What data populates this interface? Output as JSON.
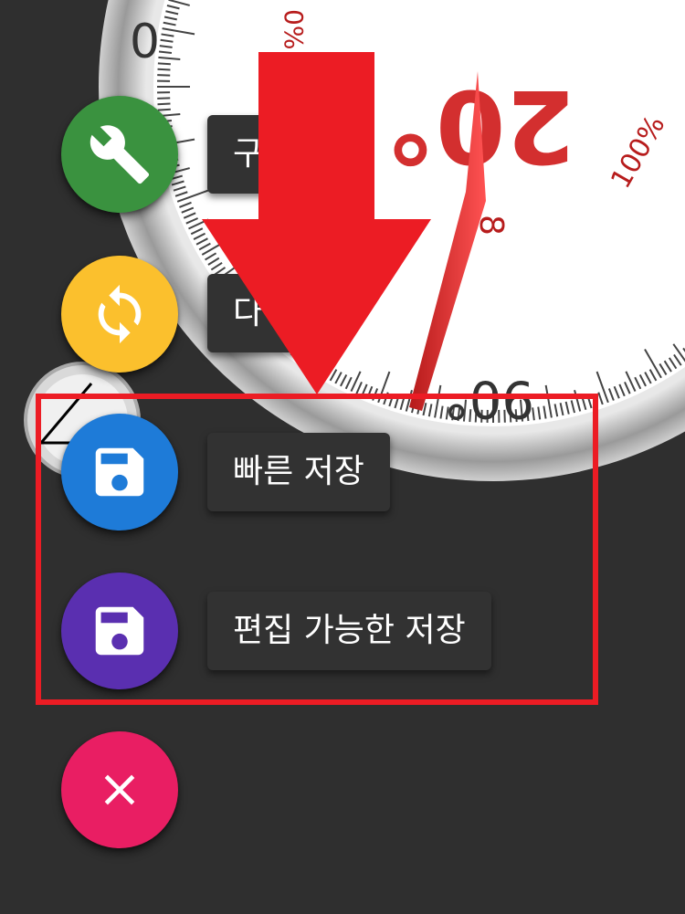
{
  "gauge": {
    "labels": {
      "zero": "0",
      "pct_zero": "0%",
      "big_top": "20°",
      "ninety": "90°",
      "eight": "8",
      "pct_hundred": "100%"
    }
  },
  "menu": {
    "items": [
      {
        "label": "구 정",
        "icon": "wrench-icon",
        "color": "#3a923f"
      },
      {
        "label": "다 기",
        "icon": "refresh-icon",
        "color": "#fbc02d"
      },
      {
        "label": "빠른 저장",
        "icon": "floppy-disk-icon",
        "color": "#1e7bd8"
      },
      {
        "label": "편집 가능한 저장",
        "icon": "floppy-disk-icon",
        "color": "#5a2fb0"
      }
    ],
    "close": {
      "icon": "close-icon",
      "color": "#e91e63"
    }
  },
  "annotation": {
    "arrow_color": "#ec1c24",
    "box_color": "#ec1c24"
  }
}
